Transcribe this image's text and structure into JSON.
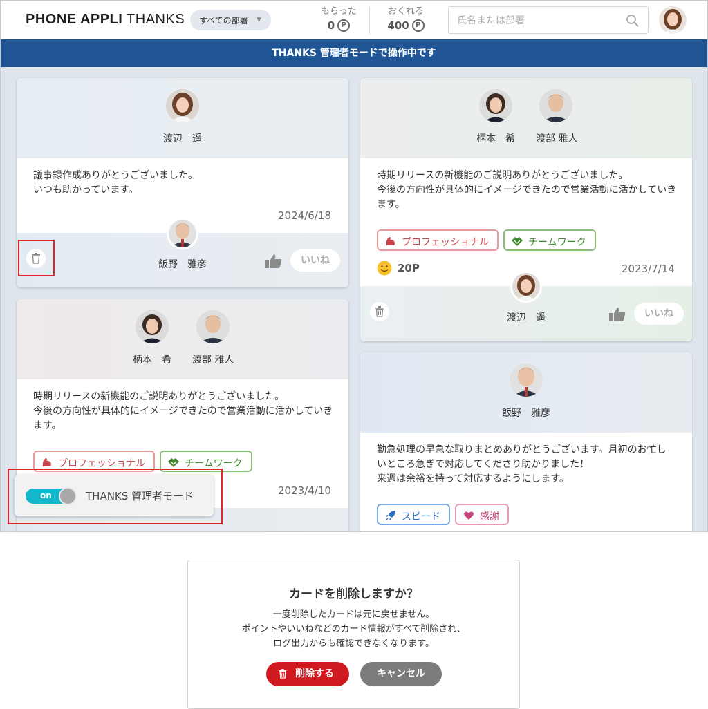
{
  "header": {
    "logo_bold": "PHONE APPLI",
    "logo_light": "THANKS",
    "dept_select": "すべての部署",
    "received_label": "もらった",
    "received_value": "0",
    "give_label": "おくれる",
    "give_value": "400",
    "point_symbol": "P",
    "search_placeholder": "氏名または部署"
  },
  "banner": "THANKS 管理者モードで操作中です",
  "cards": [
    {
      "recipients": [
        "渡辺　遥"
      ],
      "message_lines": [
        "議事録作成ありがとうございました。",
        "いつも助かっています。"
      ],
      "date": "2024/6/18",
      "sender": "飯野　雅彦",
      "like_label": "いいね"
    },
    {
      "recipients": [
        "柄本　希",
        "渡部 雅人"
      ],
      "message_lines": [
        "時期リリースの新機能のご説明ありがとうございました。",
        "今後の方向性が具体的にイメージできたので営業活動に活かしていき",
        "ます。"
      ],
      "tags": [
        "プロフェッショナル",
        "チームワーク"
      ],
      "date": "2023/4/10"
    },
    {
      "recipients": [
        "柄本　希",
        "渡部 雅人"
      ],
      "message_lines": [
        "時期リリースの新機能のご説明ありがとうございました。",
        "今後の方向性が具体的にイメージできたので営業活動に活かしていき",
        "ます。"
      ],
      "tags": [
        "プロフェッショナル",
        "チームワーク"
      ],
      "points": "20P",
      "date": "2023/7/14",
      "sender": "渡辺　遥",
      "like_label": "いいね"
    },
    {
      "recipients": [
        "飯野　雅彦"
      ],
      "message_lines": [
        "勤急処理の早急な取りまとめありがとうございます。月初のお忙し",
        "いところ急ぎで対応してくださり助かりました！",
        "来週は余裕を持って対応するようにします。"
      ],
      "tags": [
        "スピード",
        "感謝"
      ]
    }
  ],
  "toggle": {
    "state": "on",
    "label": "THANKS 管理者モード"
  },
  "dialog": {
    "title": "カードを削除しますか？",
    "body_lines": [
      "一度削除したカードは元に戻せません。",
      "ポイントやいいねなどのカード情報がすべて削除され、",
      "ログ出力からも確認できなくなります。"
    ],
    "delete_label": "削除する",
    "cancel_label": "キャンセル"
  },
  "colors": {
    "banner": "#1f5594",
    "highlight": "#e0262b",
    "toggle_on": "#14b7cc",
    "delete_button": "#cf1b1f"
  }
}
